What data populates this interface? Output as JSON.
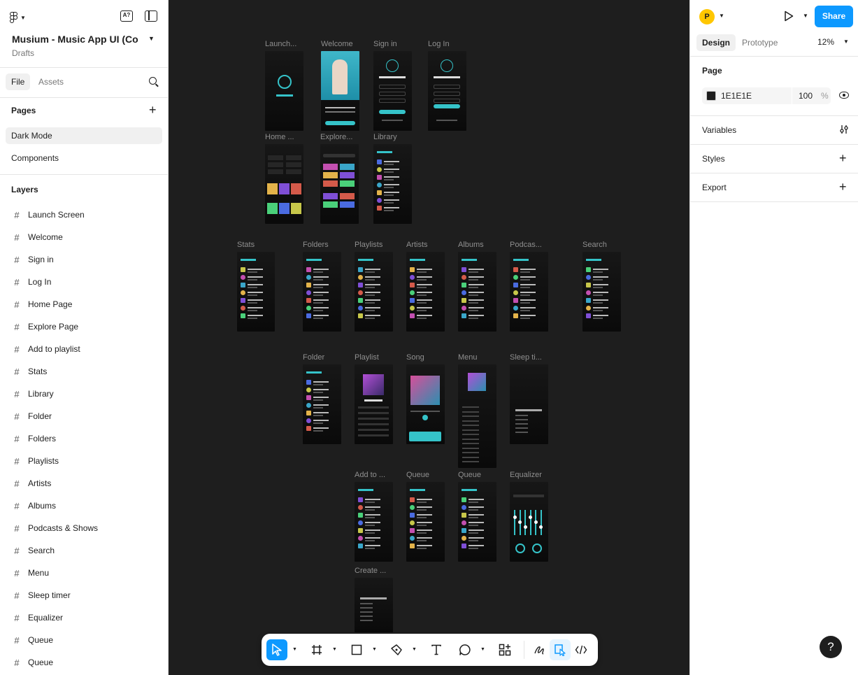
{
  "file": {
    "title": "Musium - Music App UI (Co...",
    "location": "Drafts"
  },
  "left_panel": {
    "tabs": [
      "File",
      "Assets"
    ],
    "pages_title": "Pages",
    "pages": [
      "Dark Mode",
      "Components"
    ],
    "selected_page": "Dark Mode",
    "layers_title": "Layers",
    "layers": [
      "Launch Screen",
      "Welcome",
      "Sign in",
      "Log In",
      "Home Page",
      "Explore Page",
      "Add to playlist",
      "Stats",
      "Library",
      "Folder",
      "Folders",
      "Playlists",
      "Artists",
      "Albums",
      "Podcasts & Shows",
      "Search",
      "Menu",
      "Sleep timer",
      "Equalizer",
      "Queue",
      "Queue"
    ]
  },
  "canvas": {
    "frames": [
      "Launch...",
      "Welcome",
      "Sign in",
      "Log In",
      "Home ...",
      "Explore...",
      "Library",
      "Stats",
      "Folders",
      "Playlists",
      "Artists",
      "Albums",
      "Podcas...",
      "Search",
      "Folder",
      "Playlist",
      "Song",
      "Menu",
      "Sleep ti...",
      "Add to ...",
      "Queue",
      "Queue",
      "Equalizer",
      "Create ..."
    ]
  },
  "toolbar": {
    "tools": [
      "move-tool",
      "frame-tool",
      "shape-tool",
      "pen-tool",
      "text-tool",
      "comment-tool",
      "actions-tool",
      "draw-mode",
      "design-mode",
      "dev-mode"
    ],
    "active_tool": "move-tool"
  },
  "right_panel": {
    "avatar_initial": "P",
    "share_label": "Share",
    "tabs": [
      "Design",
      "Prototype"
    ],
    "zoom": "12%",
    "page_section": "Page",
    "page_color": "1E1E1E",
    "page_opacity": "100",
    "opacity_unit": "%",
    "sections": [
      "Variables",
      "Styles",
      "Export"
    ],
    "help": "?"
  },
  "colors": {
    "canvas_bg": "#1e1e1e",
    "accent": "#0d99ff",
    "app_accent": "#35c3c9",
    "avatar": "#ffc700"
  }
}
